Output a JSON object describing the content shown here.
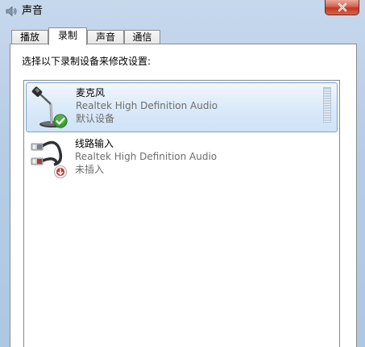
{
  "window": {
    "title": "声音"
  },
  "icons": {
    "title": "speaker-icon",
    "close": "close-icon",
    "microphone": "microphone-icon",
    "line_in": "audio-cable-icon",
    "default_badge": "green-check-icon",
    "unplugged_badge": "red-down-arrow-icon"
  },
  "tabs": [
    {
      "label": "播放",
      "active": false
    },
    {
      "label": "录制",
      "active": true
    },
    {
      "label": "声音",
      "active": false
    },
    {
      "label": "通信",
      "active": false
    }
  ],
  "panel": {
    "instruction": "选择以下录制设备来修改设置:"
  },
  "devices": [
    {
      "name": "麦克风",
      "driver": "Realtek High Definition Audio",
      "status": "默认设备",
      "selected": true
    },
    {
      "name": "线路输入",
      "driver": "Realtek High Definition Audio",
      "status": "未插入",
      "selected": false
    }
  ],
  "colors": {
    "selection_border": "#7da2ce",
    "close_button": "#c4361f",
    "status_text": "#6d6d6d"
  }
}
